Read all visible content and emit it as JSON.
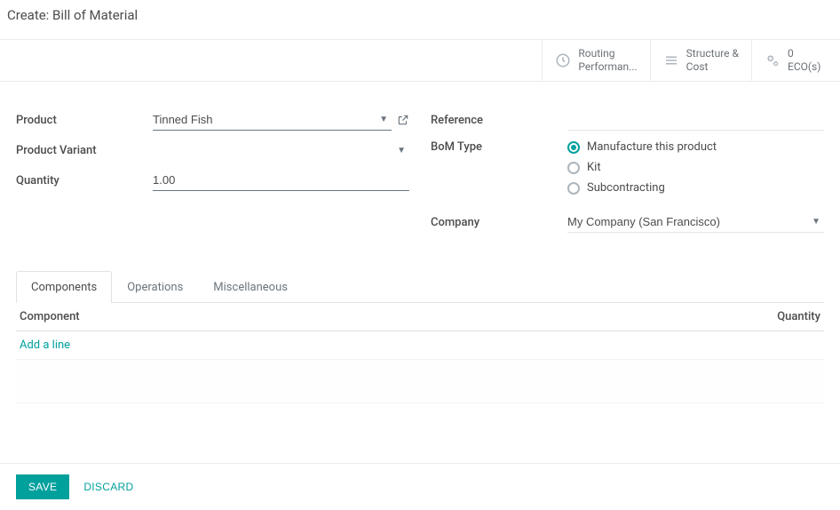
{
  "title": "Create: Bill of Material",
  "header_buttons": {
    "routing": {
      "l1": "Routing",
      "l2": "Performan..."
    },
    "structure": {
      "l1": "Structure &",
      "l2": "Cost"
    },
    "eco": {
      "l1": "0",
      "l2": "ECO(s)"
    }
  },
  "left": {
    "product_label": "Product",
    "product_value": "Tinned Fish",
    "variant_label": "Product Variant",
    "variant_value": "",
    "quantity_label": "Quantity",
    "quantity_value": "1.00"
  },
  "right": {
    "reference_label": "Reference",
    "reference_value": "",
    "bomtype_label": "BoM Type",
    "bomtype_options": {
      "manufacture": "Manufacture this product",
      "kit": "Kit",
      "subcontracting": "Subcontracting"
    },
    "company_label": "Company",
    "company_value": "My Company (San Francisco)"
  },
  "tabs": {
    "components": "Components",
    "operations": "Operations",
    "misc": "Miscellaneous"
  },
  "table": {
    "component_header": "Component",
    "quantity_header": "Quantity",
    "add_line": "Add a line"
  },
  "footer": {
    "save": "SAVE",
    "discard": "DISCARD"
  }
}
